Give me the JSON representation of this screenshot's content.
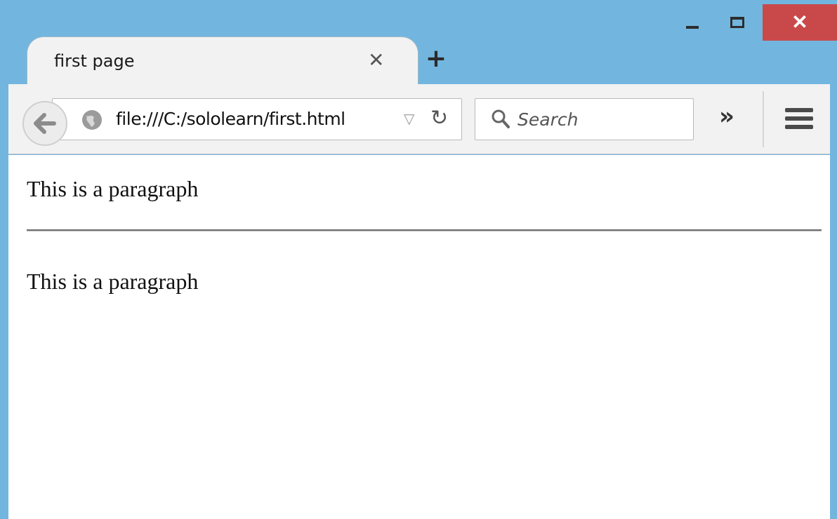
{
  "window": {
    "minimize_label": "–",
    "maximize_label": "□",
    "close_label": "✕"
  },
  "tab": {
    "title": "first page",
    "close_label": "✕",
    "new_tab_label": "+"
  },
  "toolbar": {
    "url": "file:///C:/sololearn/first.html",
    "dropmarker": "▽",
    "reload": "↻",
    "search_placeholder": "Search",
    "overflow": "»"
  },
  "content": {
    "paragraphs": [
      "This is a paragraph",
      "This is a paragraph"
    ]
  },
  "colors": {
    "frame": "#72b6df",
    "close": "#c9494a",
    "toolbar": "#f2f2f2"
  },
  "icons": [
    "back-arrow-icon",
    "globe-icon",
    "search-icon",
    "menu-icon"
  ]
}
